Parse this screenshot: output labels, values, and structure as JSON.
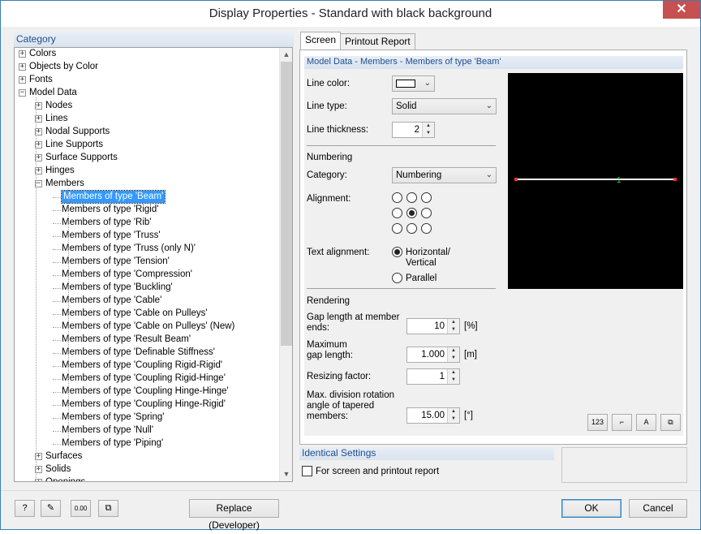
{
  "window": {
    "title": "Display Properties - Standard with black background",
    "close_glyph": "✕"
  },
  "category": {
    "header": "Category",
    "tree": [
      {
        "label": "Colors",
        "level": 0,
        "expander": "+"
      },
      {
        "label": "Objects by Color",
        "level": 0,
        "expander": "+"
      },
      {
        "label": "Fonts",
        "level": 0,
        "expander": "+"
      },
      {
        "label": "Model Data",
        "level": 0,
        "expander": "-"
      },
      {
        "label": "Nodes",
        "level": 1,
        "expander": "+"
      },
      {
        "label": "Lines",
        "level": 1,
        "expander": "+"
      },
      {
        "label": "Nodal Supports",
        "level": 1,
        "expander": "+"
      },
      {
        "label": "Line Supports",
        "level": 1,
        "expander": "+"
      },
      {
        "label": "Surface Supports",
        "level": 1,
        "expander": "+"
      },
      {
        "label": "Hinges",
        "level": 1,
        "expander": "+"
      },
      {
        "label": "Members",
        "level": 1,
        "expander": "-"
      },
      {
        "label": "Members of type 'Beam'",
        "level": 2,
        "selected": true
      },
      {
        "label": "Members of type 'Rigid'",
        "level": 2
      },
      {
        "label": "Members of type 'Rib'",
        "level": 2
      },
      {
        "label": "Members of type 'Truss'",
        "level": 2
      },
      {
        "label": "Members of type 'Truss (only N)'",
        "level": 2
      },
      {
        "label": "Members of type 'Tension'",
        "level": 2
      },
      {
        "label": "Members of type 'Compression'",
        "level": 2
      },
      {
        "label": "Members of type 'Buckling'",
        "level": 2
      },
      {
        "label": "Members of type 'Cable'",
        "level": 2
      },
      {
        "label": "Members of type 'Cable on Pulleys'",
        "level": 2
      },
      {
        "label": "Members of type 'Cable on Pulleys'  (New)",
        "level": 2
      },
      {
        "label": "Members of type 'Result Beam'",
        "level": 2
      },
      {
        "label": "Members of type 'Definable Stiffness'",
        "level": 2
      },
      {
        "label": "Members of type 'Coupling Rigid-Rigid'",
        "level": 2
      },
      {
        "label": "Members of type 'Coupling Rigid-Hinge'",
        "level": 2
      },
      {
        "label": "Members of type 'Coupling Hinge-Hinge'",
        "level": 2
      },
      {
        "label": "Members of type 'Coupling Hinge-Rigid'",
        "level": 2
      },
      {
        "label": "Members of type 'Spring'",
        "level": 2
      },
      {
        "label": "Members of type 'Null'",
        "level": 2
      },
      {
        "label": "Members of type 'Piping'",
        "level": 2
      },
      {
        "label": "Surfaces",
        "level": 1,
        "expander": "+"
      },
      {
        "label": "Solids",
        "level": 1,
        "expander": "+"
      },
      {
        "label": "Openings",
        "level": 1,
        "expander": "+"
      }
    ],
    "scroll_up": "▲",
    "scroll_down": "▼"
  },
  "tabs": [
    {
      "label": "Screen",
      "active": true
    },
    {
      "label": "Printout Report",
      "active": false
    }
  ],
  "model": {
    "header": "Model Data - Members - Members of type 'Beam'",
    "line_color_label": "Line color:",
    "line_type_label": "Line type:",
    "line_type_value": "Solid",
    "line_thickness_label": "Line thickness:",
    "line_thickness_value": "2",
    "numbering_title": "Numbering",
    "category_label": "Category:",
    "category_value": "Numbering",
    "alignment_label": "Alignment:",
    "alignment_selected": 4,
    "text_alignment_label": "Text alignment:",
    "text_align_opt1_line1": "Horizontal/",
    "text_align_opt1_line2": "Vertical",
    "text_align_opt2": "Parallel",
    "text_align_selected": "horizontal",
    "rendering_title": "Rendering",
    "gap_label_1": "Gap length at member",
    "gap_label_2": "ends:",
    "gap_value": "10",
    "gap_unit": "[%]",
    "maxgap_label_1": "Maximum",
    "maxgap_label_2": "gap length:",
    "maxgap_value": "1.000",
    "maxgap_unit": "[m]",
    "resize_label": "Resizing factor:",
    "resize_value": "1",
    "rot_label_1": "Max. division rotation",
    "rot_label_2": "angle of tapered",
    "rot_label_3": "members:",
    "rot_value": "15.00",
    "rot_unit": "[°]",
    "preview_member_number": "1",
    "preview_buttons": [
      {
        "name": "numbering-icon",
        "glyph": "123"
      },
      {
        "name": "axis-icon",
        "glyph": "⌐"
      },
      {
        "name": "font-color-icon",
        "glyph": "A"
      },
      {
        "name": "copy-settings-icon",
        "glyph": "⧉"
      }
    ]
  },
  "identical": {
    "header": "Identical Settings",
    "checkbox_label": "For screen and printout report",
    "checked": false
  },
  "bottom": {
    "icon_buttons": [
      {
        "name": "help-icon",
        "glyph": "?"
      },
      {
        "name": "edit-icon",
        "glyph": "✎"
      },
      {
        "name": "units-icon",
        "glyph": "0.00"
      },
      {
        "name": "copy-icon",
        "glyph": "⧉"
      }
    ],
    "replace_label": "Replace (Developer)",
    "ok_label": "OK",
    "cancel_label": "Cancel"
  },
  "colors": {
    "accent": "#3399ff",
    "header_text": "#1f4e8c",
    "preview_bg": "#000000",
    "preview_line": "#ffffff",
    "preview_endpoint": "#ff3030",
    "preview_number": "#33dd33"
  }
}
